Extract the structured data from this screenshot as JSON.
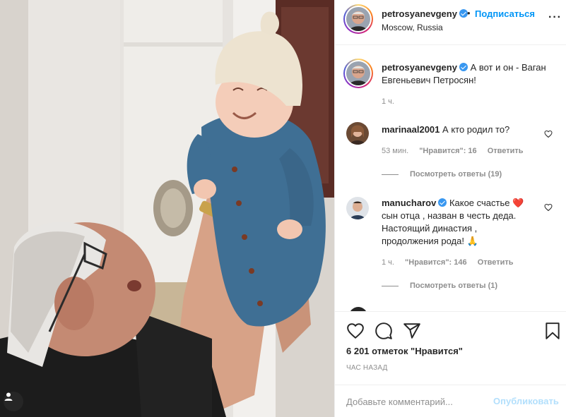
{
  "post": {
    "image_alt": "Фото",
    "header": {
      "username": "petrosyanevgeny",
      "verified": true,
      "separator": "•",
      "follow_label": "Подписаться",
      "location": "Moscow, Russia",
      "more_label": "···"
    },
    "caption": {
      "username": "petrosyanevgeny",
      "verified": true,
      "text": "А вот и он - Ваган Евгеньевич Петросян!",
      "time": "1 ч."
    },
    "comments": [
      {
        "username": "marinaal2001",
        "verified": false,
        "text": "А кто родил то?",
        "time": "53 мин.",
        "likes": "\"Нравится\": 16",
        "reply_label": "Ответить",
        "view_replies": "Посмотреть ответы (19)"
      },
      {
        "username": "manucharov",
        "verified": true,
        "text_line1": "Какое счастье",
        "text_line2": "сын отца , назван в честь деда.",
        "text_line3": "Настоящий династия ,",
        "text_line4": "продолжения рода!",
        "emoji_heart": "❤️",
        "emoji_pray": "🙏",
        "time": "1 ч.",
        "likes": "\"Нравится\": 146",
        "reply_label": "Ответить",
        "view_replies": "Посмотреть ответы (1)"
      }
    ],
    "actions": {
      "like_icon": "heart-icon",
      "comment_icon": "comment-icon",
      "share_icon": "share-icon",
      "save_icon": "bookmark-icon"
    },
    "likes_count": "6 201 отметок \"Нравится\"",
    "time_ago": "ЧАС НАЗАД",
    "add_comment": {
      "placeholder": "Добавьте комментарий...",
      "post_label": "Опубликовать"
    }
  },
  "colors": {
    "accent": "#0095f6",
    "accent_disabled": "#b2dffc",
    "text": "#262626",
    "muted": "#8e8e8e",
    "border": "#efefef",
    "verified": "#3897f0",
    "heart": "#ed4956"
  }
}
